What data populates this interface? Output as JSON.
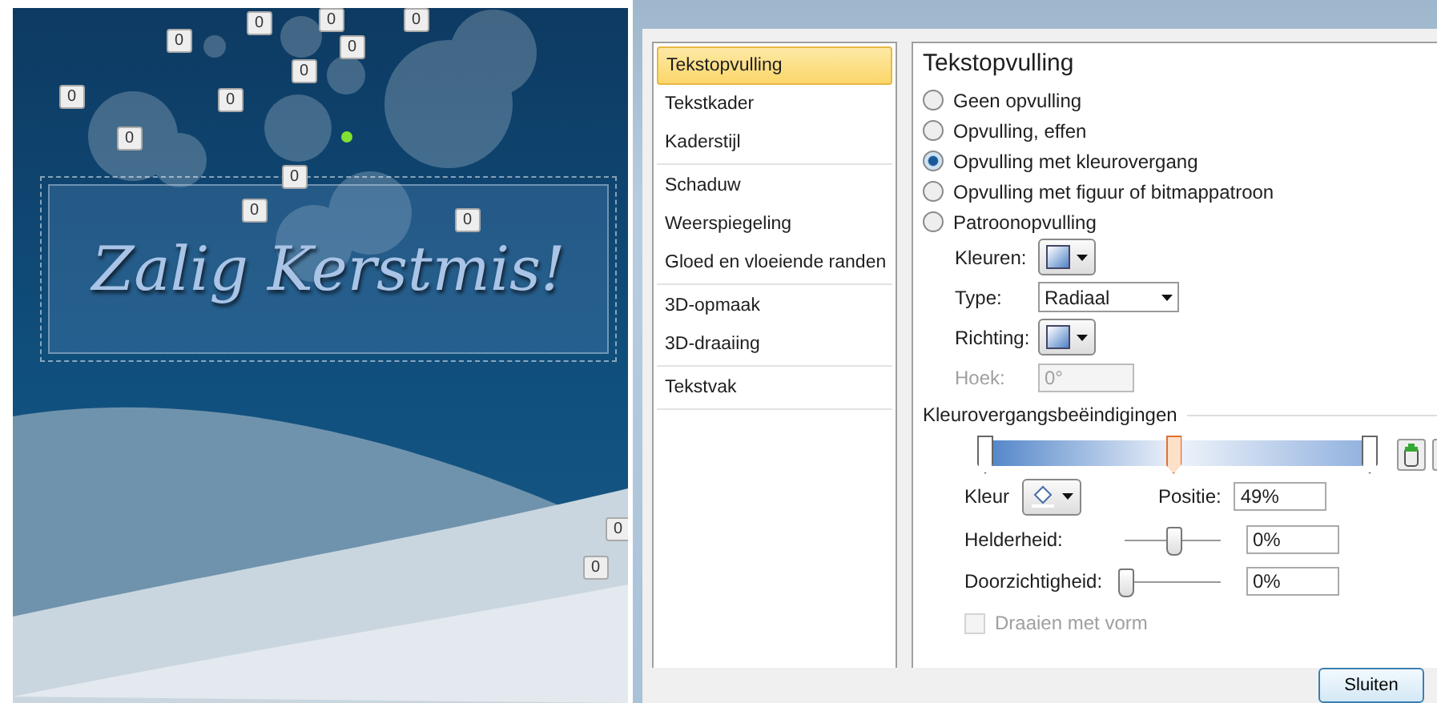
{
  "slide": {
    "greeting": "Zalig Kerstmis!",
    "badges": [
      "0",
      "0",
      "0",
      "0",
      "0",
      "0",
      "0",
      "0",
      "0",
      "0",
      "0",
      "0",
      "0",
      "0"
    ]
  },
  "dialog": {
    "nav_groups": [
      [
        {
          "label": "Tekstopvulling",
          "selected": true
        },
        {
          "label": "Tekstkader",
          "selected": false
        },
        {
          "label": "Kaderstijl",
          "selected": false
        }
      ],
      [
        {
          "label": "Schaduw",
          "selected": false
        },
        {
          "label": "Weerspiegeling",
          "selected": false
        },
        {
          "label": "Gloed en vloeiende randen",
          "selected": false
        }
      ],
      [
        {
          "label": "3D-opmaak",
          "selected": false
        },
        {
          "label": "3D-draaiing",
          "selected": false
        }
      ],
      [
        {
          "label": "Tekstvak",
          "selected": false
        }
      ]
    ],
    "heading": "Tekstopvulling",
    "fill_options": [
      {
        "label": "Geen opvulling",
        "selected": false
      },
      {
        "label": "Opvulling, effen",
        "selected": false
      },
      {
        "label": "Opvulling met kleurovergang",
        "selected": true
      },
      {
        "label": "Opvulling met figuur of bitmappatroon",
        "selected": false
      },
      {
        "label": "Patroonopvulling",
        "selected": false
      }
    ],
    "fields": [
      {
        "kind": "swatch",
        "label": "Kleuren:",
        "disabled": false
      },
      {
        "kind": "select",
        "label": "Type:",
        "value": "Radiaal",
        "disabled": false
      },
      {
        "kind": "swatch",
        "label": "Richting:",
        "disabled": false
      },
      {
        "kind": "spin",
        "label": "Hoek:",
        "value": "0°",
        "disabled": true
      }
    ],
    "stops_title": "Kleurovergangsbeëindigingen",
    "stops": [
      {
        "level": 0,
        "selected": false
      },
      {
        "level": 0.49,
        "selected": true
      },
      {
        "level": 1,
        "selected": false
      }
    ],
    "color_label": "Kleur",
    "position_label": "Positie:",
    "position_value": "49%",
    "sliders": [
      {
        "label": "Helderheid:",
        "level": 0.5,
        "value": "0%"
      },
      {
        "label": "Doorzichtigheid:",
        "level": 0,
        "value": "0%"
      }
    ],
    "rotate": {
      "label": "Draaien met vorm",
      "checked": false,
      "disabled": true
    },
    "close_button": "Sluiten"
  }
}
